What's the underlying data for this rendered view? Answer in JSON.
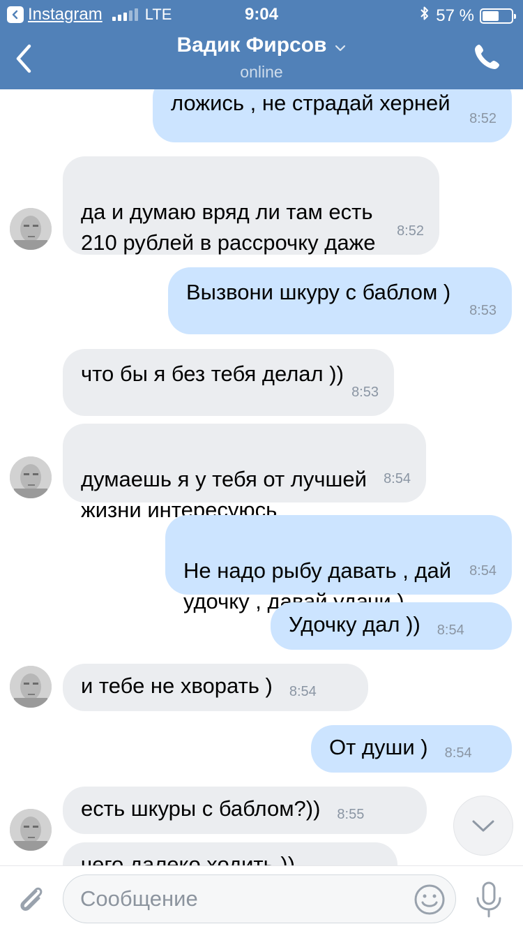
{
  "status_bar": {
    "back_app_label": "Instagram",
    "network": "LTE",
    "time": "9:04",
    "battery_text": "57 %",
    "battery_level": 0.57
  },
  "header": {
    "title": "Вадик Фирсов",
    "subtitle": "online"
  },
  "messages": [
    {
      "dir": "out",
      "text": "ложись , не страдай херней",
      "time": "8:52"
    },
    {
      "dir": "in",
      "text": "да и думаю вряд ли там есть\n210 рублей в рассрочку даже",
      "time": "8:52"
    },
    {
      "dir": "out",
      "text": "Вызвони шкуру с баблом )",
      "time": "8:53"
    },
    {
      "dir": "in",
      "text": "что бы я без тебя делал ))",
      "time": "8:53"
    },
    {
      "dir": "in",
      "text": "думаешь я у тебя от лучшей\nжизни интересуюсь",
      "time": "8:54"
    },
    {
      "dir": "out",
      "text": "Не надо рыбу давать , дай\nудочку , давай удачи )",
      "time": "8:54"
    },
    {
      "dir": "out",
      "text": "Удочку дал ))",
      "time": "8:54"
    },
    {
      "dir": "in",
      "text": "и тебе не хворать )",
      "time": "8:54"
    },
    {
      "dir": "out",
      "text": "От души )",
      "time": "8:54"
    },
    {
      "dir": "in",
      "text": "есть шкуры с баблом?))",
      "time": "8:55"
    },
    {
      "dir": "in",
      "text": "чего далеко ходить ))",
      "time": ""
    }
  ],
  "composer": {
    "placeholder": "Сообщение"
  },
  "icons": {
    "back": "chevron-left-icon",
    "title_dropdown": "chevron-down-icon",
    "call": "phone-icon",
    "scroll_down": "chevron-down-icon",
    "attach": "paperclip-icon",
    "emoji": "smiley-icon",
    "mic": "microphone-icon"
  },
  "colors": {
    "header": "#5181b8",
    "incoming_bubble": "#ebedf0",
    "outgoing_bubble": "#cce4ff",
    "time_text": "#8a95a3"
  }
}
